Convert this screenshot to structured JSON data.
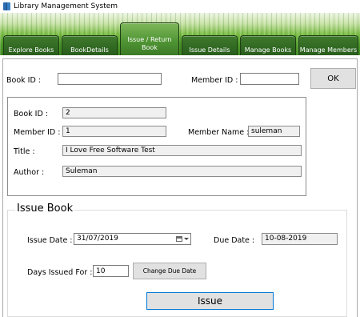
{
  "window": {
    "title": "Library Management System"
  },
  "tabs": [
    {
      "label": "Explore Books"
    },
    {
      "label": "BookDetails"
    },
    {
      "label": "Issue / Return\nBook"
    },
    {
      "label": "Issue Details"
    },
    {
      "label": "Manage Books"
    },
    {
      "label": "Manage Members"
    }
  ],
  "search": {
    "book_id_label": "Book ID :",
    "book_id_value": "",
    "member_id_label": "Member ID :",
    "member_id_value": "",
    "ok_label": "OK"
  },
  "details": {
    "book_id_label": "Book ID :",
    "book_id_value": "2",
    "member_id_label": "Member ID :",
    "member_id_value": "1",
    "member_name_label": "Member Name :",
    "member_name_value": "suleman",
    "title_label": "Title :",
    "title_value": "I Love Free Software Test",
    "author_label": "Author :",
    "author_value": "Suleman"
  },
  "issue": {
    "group_title": "Issue Book",
    "issue_date_label": "Issue Date :",
    "issue_date_value": "31/07/2019",
    "due_date_label": "Due Date :",
    "due_date_value": "10-08-2019",
    "days_label": "Days Issued For :",
    "days_value": "10",
    "change_due_label": "Change Due Date",
    "issue_button_label": "Issue"
  },
  "colors": {
    "tab_green": "#2d6320",
    "issue_button_border": "#0078d7"
  },
  "icons": {
    "app": "book-icon",
    "calendar": "calendar-icon",
    "dropdown": "chevron-down-icon"
  }
}
